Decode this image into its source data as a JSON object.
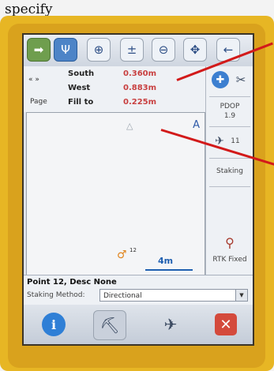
{
  "caption": "specify",
  "toolbar": {
    "buttons": [
      {
        "icon": "back-arrow-icon",
        "glyph": "➡"
      },
      {
        "icon": "pole-icon",
        "glyph": "Ψ"
      },
      {
        "icon": "zoom-extents-icon",
        "glyph": "⊕"
      },
      {
        "icon": "zoom-in-icon",
        "glyph": "±"
      },
      {
        "icon": "zoom-out-icon",
        "glyph": "⊖"
      },
      {
        "icon": "pan-icon",
        "glyph": "✥"
      },
      {
        "icon": "arrow-left-icon",
        "glyph": "←"
      }
    ]
  },
  "readouts": {
    "nav": "« »",
    "page_label": "Page",
    "rows": [
      {
        "label": "South",
        "value": "0.360m"
      },
      {
        "label": "West",
        "value": "0.883m"
      },
      {
        "label": "Fill to",
        "value": "0.225m"
      }
    ]
  },
  "status": {
    "pdop_label": "PDOP",
    "pdop_value": "1.9",
    "satellites": "11",
    "mode": "Staking",
    "rtk": "RTK Fixed"
  },
  "map": {
    "north": "A",
    "target": "△",
    "user_sup": "12",
    "scale": "4m"
  },
  "info": {
    "point_desc": "Point 12, Desc None",
    "method_label": "Staking Method:",
    "method_value": "Directional"
  },
  "colors": {
    "device_yellow": "#e7b624",
    "readout_red": "#c84040",
    "pointer_red": "#d21a1a",
    "accent_blue": "#1f5fb0"
  }
}
